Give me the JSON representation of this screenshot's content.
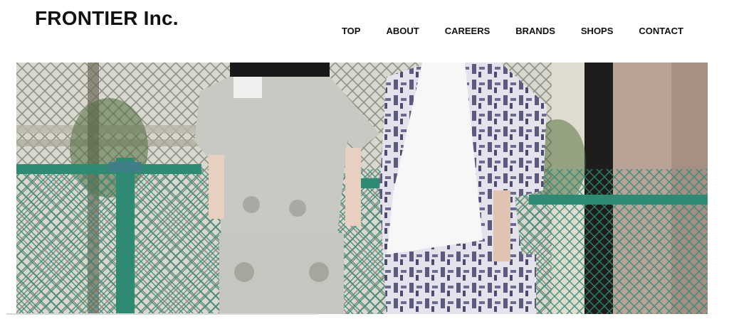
{
  "header": {
    "logo_text": "FRONTIER Inc."
  },
  "nav": {
    "items": [
      {
        "label": "TOP"
      },
      {
        "label": "ABOUT"
      },
      {
        "label": "CAREERS"
      },
      {
        "label": "BRANDS"
      },
      {
        "label": "SHOPS"
      },
      {
        "label": "CONTACT"
      }
    ]
  },
  "hero": {
    "image_name": "hero-photo"
  },
  "colors": {
    "text": "#111111",
    "fence_green": "#2e8a72",
    "background": "#ffffff"
  }
}
